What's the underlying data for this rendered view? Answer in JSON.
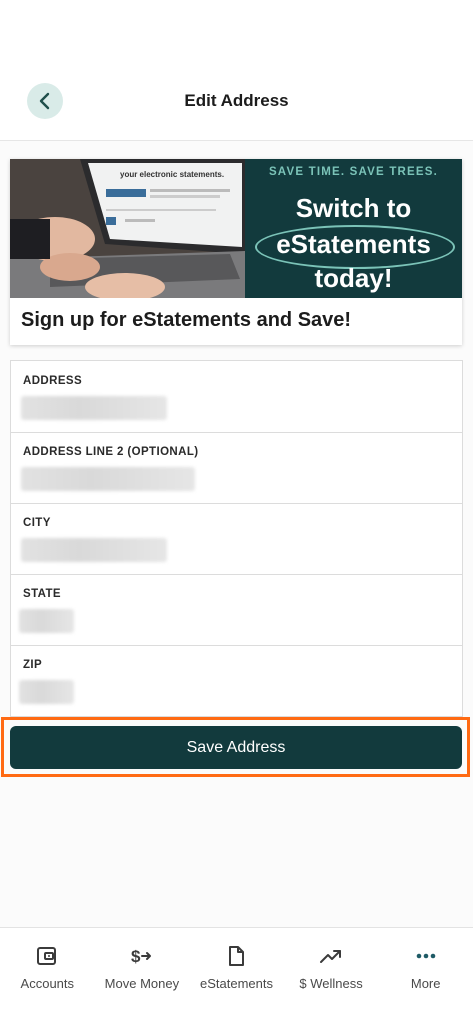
{
  "header": {
    "title": "Edit Address",
    "back_icon": "chevron-left-icon"
  },
  "promo": {
    "tagline": "SAVE TIME. SAVE TREES.",
    "line1": "Switch to",
    "line2": "eStatements",
    "line3": "today!",
    "screen_text": "your electronic statements.",
    "caption": "Sign up for eStatements and Save!"
  },
  "form": {
    "fields": [
      {
        "label": "ADDRESS",
        "value": ""
      },
      {
        "label": "ADDRESS LINE 2 (OPTIONAL)",
        "value": ""
      },
      {
        "label": "CITY",
        "value": ""
      },
      {
        "label": "STATE",
        "value": ""
      },
      {
        "label": "ZIP",
        "value": ""
      }
    ]
  },
  "save_button": {
    "label": "Save Address"
  },
  "bottom_nav": {
    "items": [
      {
        "label": "Accounts",
        "icon": "wallet-icon"
      },
      {
        "label": "Move Money",
        "icon": "transfer-money-icon"
      },
      {
        "label": "eStatements",
        "icon": "document-icon"
      },
      {
        "label": "$ Wellness",
        "icon": "trend-up-icon"
      },
      {
        "label": "More",
        "icon": "more-dots-icon"
      }
    ]
  },
  "colors": {
    "primary": "#123a3d",
    "accent": "#7bc3b8",
    "highlight": "#ff6a13",
    "back_button_bg": "#d9ebe8"
  }
}
